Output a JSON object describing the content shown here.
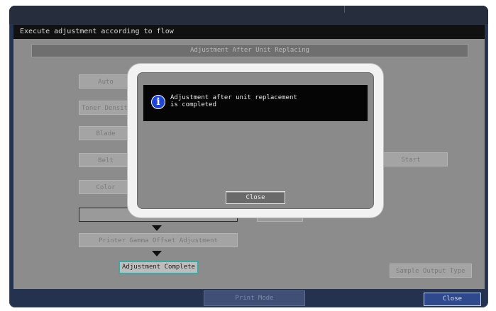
{
  "screen": {
    "header": "Execute adjustment according to flow",
    "subtitle": "Adjustment After Unit Replacing"
  },
  "flow": {
    "steps": [
      "Auto",
      "Toner Density",
      "Blade",
      "Belt",
      "Color",
      "",
      "Printer Gamma Offset Adjustment"
    ],
    "final": "Adjustment Complete",
    "start_label": "Start",
    "sample_label": "Sample Output Type"
  },
  "footer": {
    "print_mode": "Print Mode",
    "close": "Close"
  },
  "dialog": {
    "message_line1": "Adjustment after unit replacement",
    "message_line2": "is completed",
    "info_glyph": "i",
    "close_label": "Close"
  }
}
